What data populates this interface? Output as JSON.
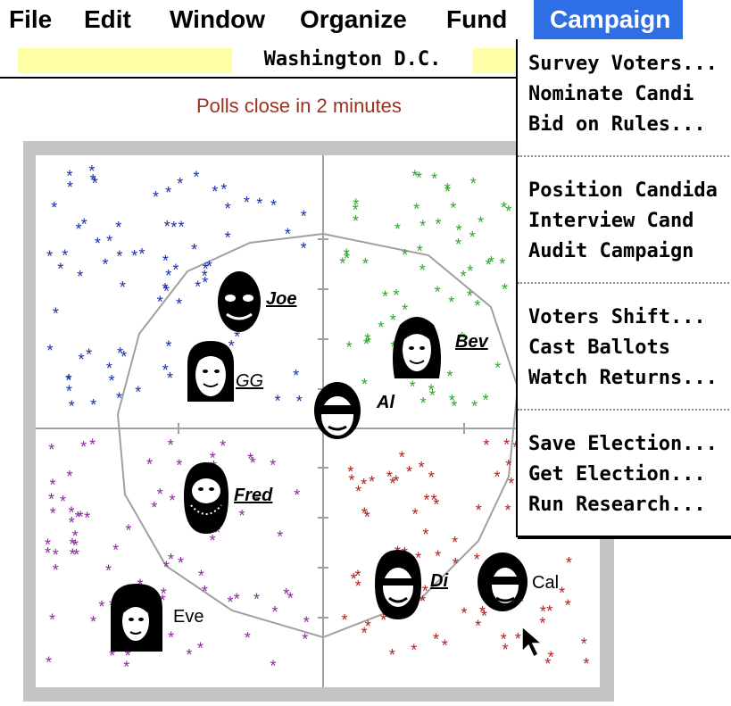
{
  "menubar": {
    "items": [
      {
        "label": "File"
      },
      {
        "label": "Edit"
      },
      {
        "label": "Window"
      },
      {
        "label": "Organize"
      },
      {
        "label": "Fund"
      },
      {
        "label": "Campaign",
        "active": true
      }
    ]
  },
  "header": {
    "title": "Washington D.C.",
    "strip_color": "#ffffa8"
  },
  "status_text": "Polls close in 2 minutes",
  "colors": {
    "menu_active": "#2f6fe6",
    "status_text": "#a03020",
    "voters_blue": "#1a2fa8",
    "voters_green": "#2aa82a",
    "voters_purple": "#8a2a9a",
    "voters_red": "#b02020",
    "field_border": "#c4c4c4",
    "field_lines": "#a0a0a0"
  },
  "candidates": [
    {
      "name": "Joe",
      "underline": true
    },
    {
      "name": "GG",
      "underline": true
    },
    {
      "name": "Al",
      "underline": false
    },
    {
      "name": "Bev",
      "underline": true
    },
    {
      "name": "Fred",
      "underline": true
    },
    {
      "name": "Di",
      "underline": true
    },
    {
      "name": "Cal",
      "underline": false
    },
    {
      "name": "Eve",
      "underline": false
    }
  ],
  "campaign_menu": {
    "groups": [
      [
        "Survey Voters...",
        "Nominate Candi",
        "Bid on Rules..."
      ],
      [
        "Position Candida",
        "Interview Cand",
        "Audit Campaign"
      ],
      [
        "Voters Shift...",
        "Cast Ballots",
        "Watch Returns..."
      ],
      [
        "Save Election...",
        "Get Election...",
        "Run Research..."
      ]
    ]
  },
  "icons": {
    "voter_marker": "asterisk",
    "cursor": "arrow-cursor-icon"
  }
}
